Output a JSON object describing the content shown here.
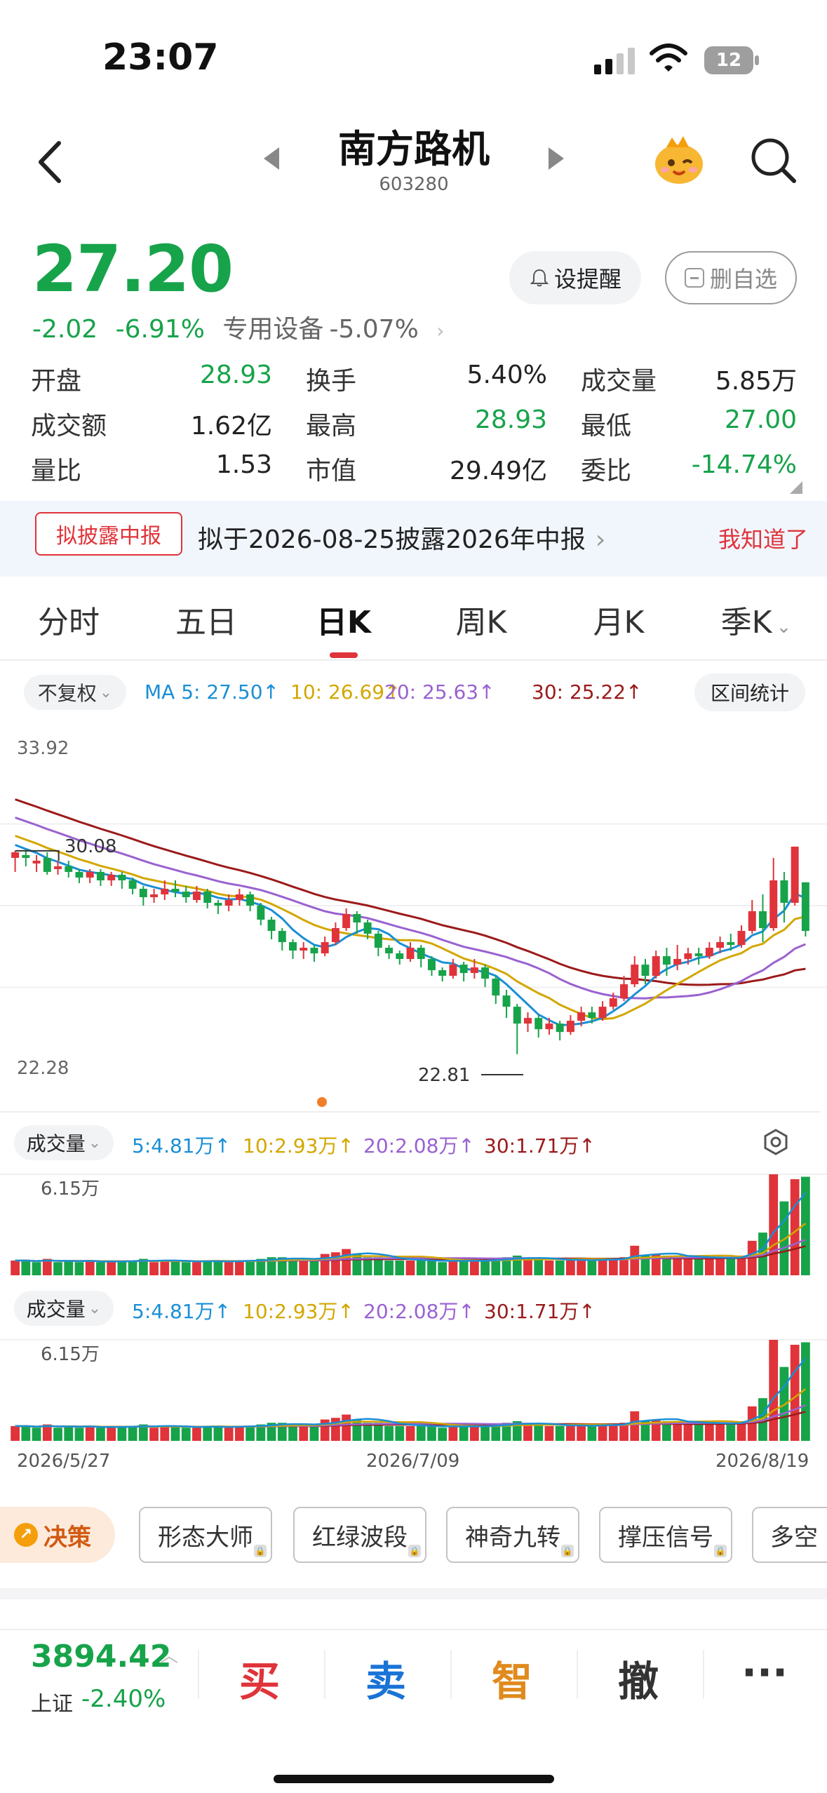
{
  "status": {
    "time": "23:07",
    "battery": "12"
  },
  "nav": {
    "name": "南方路机",
    "code": "603280",
    "icons": [
      "back-icon",
      "prev-arrow-icon",
      "next-arrow-icon",
      "mascot-icon",
      "search-icon"
    ]
  },
  "quote": {
    "price": "27.20",
    "change": "-2.02",
    "change_pct": "-6.91%",
    "sector": "专用设备",
    "sector_pct": "-5.07%",
    "alert_label": "设提醒",
    "watch_label": "删自选"
  },
  "stats": [
    [
      {
        "label": "开盘",
        "value": "28.93",
        "tone": "green"
      },
      {
        "label": "换手",
        "value": "5.40%",
        "tone": "plain"
      },
      {
        "label": "成交量",
        "value": "5.85万",
        "tone": "plain"
      }
    ],
    [
      {
        "label": "成交额",
        "value": "1.62亿",
        "tone": "plain"
      },
      {
        "label": "最高",
        "value": "28.93",
        "tone": "green"
      },
      {
        "label": "最低",
        "value": "27.00",
        "tone": "green"
      }
    ],
    [
      {
        "label": "量比",
        "value": "1.53",
        "tone": "plain"
      },
      {
        "label": "市值",
        "value": "29.49亿",
        "tone": "plain"
      },
      {
        "label": "委比",
        "value": "-14.74%",
        "tone": "green"
      }
    ]
  ],
  "notice": {
    "tag": "拟披露中报",
    "text": "拟于2026-08-25披露2026年中报",
    "ok": "我知道了"
  },
  "tabs": [
    "分时",
    "五日",
    "日K",
    "周K",
    "月K",
    "季K"
  ],
  "active_tab": 2,
  "chart_header": {
    "adjust": "不复权",
    "ma5": "MA 5: 27.50",
    "ma10": "10: 26.69",
    "ma20": "20: 25.63",
    "ma30": "30: 25.22",
    "range_stats": "区间统计"
  },
  "chart_labels": {
    "max": "33.92",
    "local_high": "30.08",
    "min_axis": "22.28",
    "low": "22.81"
  },
  "volume_header": {
    "label": "成交量",
    "ma5": "5:4.81万",
    "ma10": "10:2.93万",
    "ma20": "20:2.08万",
    "ma30": "30:1.71万",
    "top": "6.15万",
    "zero": "0"
  },
  "dates": [
    "2026/5/27",
    "2026/7/09",
    "2026/8/19"
  ],
  "decision": {
    "label": "决策",
    "tools": [
      "形态大师",
      "红绿波段",
      "神奇九转",
      "撑压信号",
      "多空"
    ]
  },
  "bottom": {
    "index_value": "3894.42",
    "index_name": "上证",
    "index_chg": "-2.40%",
    "buttons": [
      "买",
      "卖",
      "智",
      "撤",
      "···"
    ]
  },
  "colors": {
    "up": "#e0333a",
    "down": "#17a34a",
    "ma5": "#1a8fd6",
    "ma10": "#d3a700",
    "ma20": "#9a62d0",
    "ma30": "#9b1a1a"
  },
  "chart_data": {
    "type": "candlestick",
    "x_start": "2026/5/27",
    "x_mid": "2026/7/09",
    "x_end": "2026/8/19",
    "candles": [
      [
        29.8,
        30.0,
        29.3,
        30.05
      ],
      [
        29.9,
        29.8,
        29.5,
        30.1
      ],
      [
        29.6,
        29.7,
        29.3,
        29.9
      ],
      [
        29.8,
        29.3,
        29.2,
        30.0
      ],
      [
        29.4,
        29.5,
        29.2,
        29.7
      ],
      [
        29.5,
        29.3,
        29.1,
        29.7
      ],
      [
        29.3,
        29.1,
        28.9,
        29.4
      ],
      [
        29.1,
        29.3,
        28.9,
        29.4
      ],
      [
        29.3,
        29.0,
        28.8,
        29.4
      ],
      [
        29.0,
        29.2,
        28.8,
        29.3
      ],
      [
        29.2,
        29.0,
        28.7,
        29.3
      ],
      [
        29.0,
        28.7,
        28.5,
        29.1
      ],
      [
        28.7,
        28.4,
        28.1,
        28.8
      ],
      [
        28.4,
        28.5,
        28.2,
        28.7
      ],
      [
        28.5,
        28.7,
        28.3,
        29.0
      ],
      [
        28.7,
        28.6,
        28.4,
        29.0
      ],
      [
        28.6,
        28.4,
        28.2,
        28.8
      ],
      [
        28.3,
        28.6,
        28.2,
        28.8
      ],
      [
        28.6,
        28.2,
        28.0,
        28.7
      ],
      [
        28.2,
        28.1,
        27.8,
        28.3
      ],
      [
        28.1,
        28.3,
        27.9,
        28.5
      ],
      [
        28.3,
        28.5,
        28.1,
        28.7
      ],
      [
        28.5,
        28.1,
        27.9,
        28.6
      ],
      [
        28.1,
        27.6,
        27.4,
        28.2
      ],
      [
        27.6,
        27.2,
        26.9,
        27.7
      ],
      [
        27.2,
        26.8,
        26.5,
        27.3
      ],
      [
        26.8,
        26.5,
        26.2,
        26.9
      ],
      [
        26.5,
        26.6,
        26.2,
        26.8
      ],
      [
        26.6,
        26.4,
        26.1,
        26.7
      ],
      [
        26.4,
        26.8,
        26.3,
        27.0
      ],
      [
        26.8,
        27.3,
        26.7,
        27.5
      ],
      [
        27.3,
        27.8,
        27.2,
        28.0
      ],
      [
        27.8,
        27.5,
        27.1,
        27.9
      ],
      [
        27.5,
        27.1,
        26.9,
        27.6
      ],
      [
        27.1,
        26.6,
        26.3,
        27.2
      ],
      [
        26.6,
        26.4,
        26.2,
        26.7
      ],
      [
        26.4,
        26.2,
        26.0,
        26.5
      ],
      [
        26.2,
        26.6,
        26.1,
        26.8
      ],
      [
        26.6,
        26.2,
        25.9,
        26.7
      ],
      [
        26.2,
        25.8,
        25.6,
        26.3
      ],
      [
        25.8,
        25.6,
        25.4,
        25.9
      ],
      [
        25.6,
        26.0,
        25.5,
        26.2
      ],
      [
        26.0,
        25.7,
        25.4,
        26.1
      ],
      [
        25.7,
        25.9,
        25.5,
        26.2
      ],
      [
        25.9,
        25.5,
        25.2,
        26.0
      ],
      [
        25.5,
        24.9,
        24.6,
        25.6
      ],
      [
        24.9,
        24.5,
        24.1,
        25.1
      ],
      [
        24.5,
        23.9,
        22.81,
        24.6
      ],
      [
        23.9,
        24.1,
        23.6,
        24.3
      ],
      [
        24.1,
        23.7,
        23.4,
        24.2
      ],
      [
        23.7,
        23.9,
        23.5,
        24.1
      ],
      [
        23.9,
        23.6,
        23.3,
        24.0
      ],
      [
        23.6,
        24.0,
        23.5,
        24.2
      ],
      [
        24.0,
        24.3,
        23.8,
        24.5
      ],
      [
        24.3,
        24.1,
        23.9,
        24.5
      ],
      [
        24.1,
        24.5,
        24.0,
        24.7
      ],
      [
        24.5,
        24.8,
        24.4,
        25.0
      ],
      [
        24.8,
        25.3,
        24.7,
        25.6
      ],
      [
        25.3,
        26.0,
        25.2,
        26.3
      ],
      [
        26.0,
        25.6,
        25.3,
        26.2
      ],
      [
        25.6,
        26.3,
        25.5,
        26.5
      ],
      [
        26.3,
        26.0,
        25.6,
        26.6
      ],
      [
        26.0,
        26.2,
        25.8,
        26.7
      ],
      [
        26.2,
        26.4,
        26.0,
        26.6
      ],
      [
        26.4,
        26.3,
        26.0,
        26.6
      ],
      [
        26.3,
        26.6,
        26.2,
        26.8
      ],
      [
        26.6,
        26.8,
        26.4,
        27.0
      ],
      [
        26.8,
        26.7,
        26.5,
        27.1
      ],
      [
        26.7,
        27.2,
        26.6,
        27.4
      ],
      [
        27.2,
        27.9,
        27.1,
        28.3
      ],
      [
        27.9,
        27.3,
        26.8,
        28.5
      ],
      [
        27.3,
        29.0,
        27.2,
        29.8
      ],
      [
        29.0,
        28.2,
        27.5,
        29.3
      ],
      [
        28.2,
        30.2,
        28.1,
        30.2
      ],
      [
        28.93,
        27.2,
        27.0,
        28.93
      ]
    ],
    "volume": [
      [
        0.9,
        0
      ],
      [
        0.9,
        1
      ],
      [
        0.8,
        1
      ],
      [
        1.0,
        0
      ],
      [
        0.8,
        1
      ],
      [
        0.9,
        1
      ],
      [
        0.8,
        1
      ],
      [
        0.9,
        0
      ],
      [
        0.8,
        1
      ],
      [
        0.8,
        0
      ],
      [
        0.9,
        1
      ],
      [
        0.9,
        1
      ],
      [
        1.0,
        1
      ],
      [
        0.8,
        0
      ],
      [
        0.9,
        0
      ],
      [
        0.9,
        1
      ],
      [
        0.8,
        1
      ],
      [
        0.8,
        0
      ],
      [
        0.9,
        1
      ],
      [
        0.9,
        1
      ],
      [
        0.8,
        0
      ],
      [
        0.9,
        0
      ],
      [
        0.9,
        1
      ],
      [
        1.0,
        1
      ],
      [
        1.1,
        1
      ],
      [
        1.1,
        1
      ],
      [
        1.0,
        1
      ],
      [
        0.9,
        0
      ],
      [
        0.9,
        1
      ],
      [
        1.3,
        0
      ],
      [
        1.4,
        0
      ],
      [
        1.6,
        0
      ],
      [
        1.3,
        1
      ],
      [
        1.1,
        1
      ],
      [
        1.1,
        1
      ],
      [
        0.9,
        1
      ],
      [
        0.9,
        1
      ],
      [
        0.9,
        0
      ],
      [
        0.9,
        1
      ],
      [
        0.9,
        1
      ],
      [
        0.8,
        1
      ],
      [
        0.9,
        0
      ],
      [
        0.9,
        1
      ],
      [
        0.9,
        0
      ],
      [
        0.9,
        1
      ],
      [
        1.0,
        1
      ],
      [
        1.1,
        1
      ],
      [
        1.2,
        1
      ],
      [
        1.0,
        0
      ],
      [
        1.0,
        1
      ],
      [
        0.9,
        0
      ],
      [
        0.9,
        1
      ],
      [
        0.9,
        0
      ],
      [
        1.0,
        0
      ],
      [
        0.9,
        1
      ],
      [
        1.0,
        0
      ],
      [
        1.0,
        0
      ],
      [
        1.1,
        0
      ],
      [
        1.8,
        0
      ],
      [
        1.2,
        1
      ],
      [
        1.3,
        0
      ],
      [
        1.2,
        1
      ],
      [
        1.1,
        0
      ],
      [
        1.1,
        0
      ],
      [
        1.0,
        1
      ],
      [
        1.1,
        0
      ],
      [
        1.1,
        0
      ],
      [
        1.0,
        1
      ],
      [
        1.2,
        0
      ],
      [
        2.1,
        0
      ],
      [
        2.6,
        1
      ],
      [
        6.15,
        0
      ],
      [
        4.5,
        1
      ],
      [
        5.85,
        0
      ],
      [
        6.0,
        1
      ]
    ]
  }
}
